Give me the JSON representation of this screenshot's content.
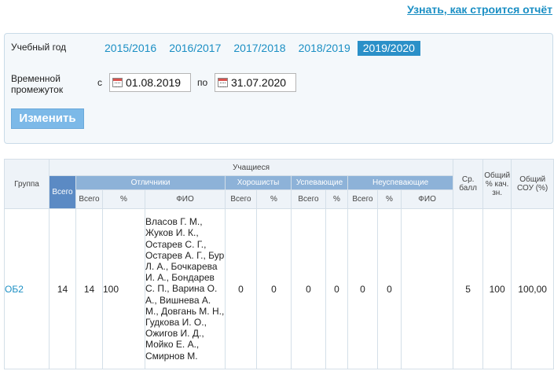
{
  "header": {
    "report_link": "Узнать, как строится отчёт"
  },
  "filter": {
    "year_label": "Учебный год",
    "years": [
      "2015/2016",
      "2016/2017",
      "2017/2018",
      "2018/2019",
      "2019/2020"
    ],
    "active_year_index": 4,
    "period_label": "Временной промежуток",
    "from_label": "с",
    "from_value": "01.08.2019",
    "to_label": "по",
    "to_value": "31.07.2020",
    "change_button": "Изменить"
  },
  "table": {
    "col_group": "Группа",
    "col_students": "Учащиеся",
    "col_total": "Всего",
    "col_excellent": "Отличники",
    "col_good": "Хорошисты",
    "col_passing": "Успевающие",
    "col_failing": "Неуспевающие",
    "col_avg": "Ср. балл",
    "col_quality": "Общий % кач. зн.",
    "col_sou": "Общий СОУ (%)",
    "sub_total": "Всего",
    "sub_pct": "%",
    "sub_fio": "ФИО",
    "rows": [
      {
        "group": "ОБ2",
        "total": "14",
        "excellent_total": "14",
        "excellent_pct": "100",
        "excellent_fio": "Власов Г. М., Жуков И. К., Остарев С. Г., Остарев А. Г., Бур Л. А., Бочкарева И. А., Бондарев С. П., Варина О. А., Вишнева А. М., Довгань М. Н., Гудкова И. О., Ожигов И. Д., Мойко Е. А., Смирнов М.",
        "good_total": "0",
        "good_pct": "0",
        "passing_total": "0",
        "passing_pct": "0",
        "failing_total": "0",
        "failing_pct": "0",
        "failing_fio": "",
        "avg": "5",
        "quality": "100",
        "sou": "100,00"
      }
    ]
  }
}
